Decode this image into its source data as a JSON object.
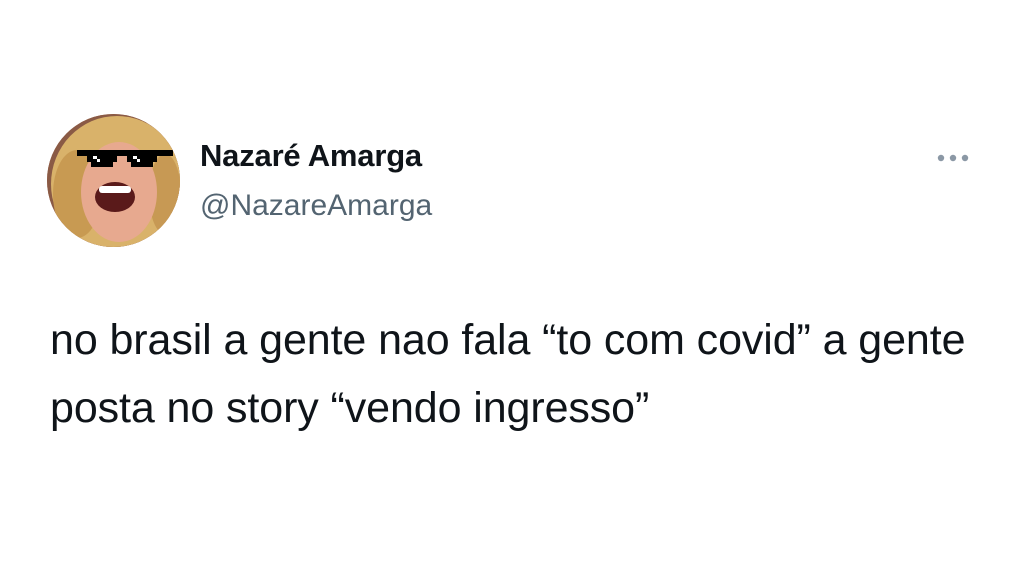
{
  "tweet": {
    "author": {
      "display_name": "Nazaré Amarga",
      "handle": "@NazareAmarga",
      "avatar_icon": "profile-photo-laughing-woman-pixel-sunglasses"
    },
    "more_icon": "more-horizontal-icon",
    "text": "no brasil a gente nao fala “to com covid” a gente posta no story “vendo ingresso”"
  },
  "colors": {
    "text_primary": "#0f1419",
    "text_secondary": "#536471",
    "background": "#ffffff"
  }
}
